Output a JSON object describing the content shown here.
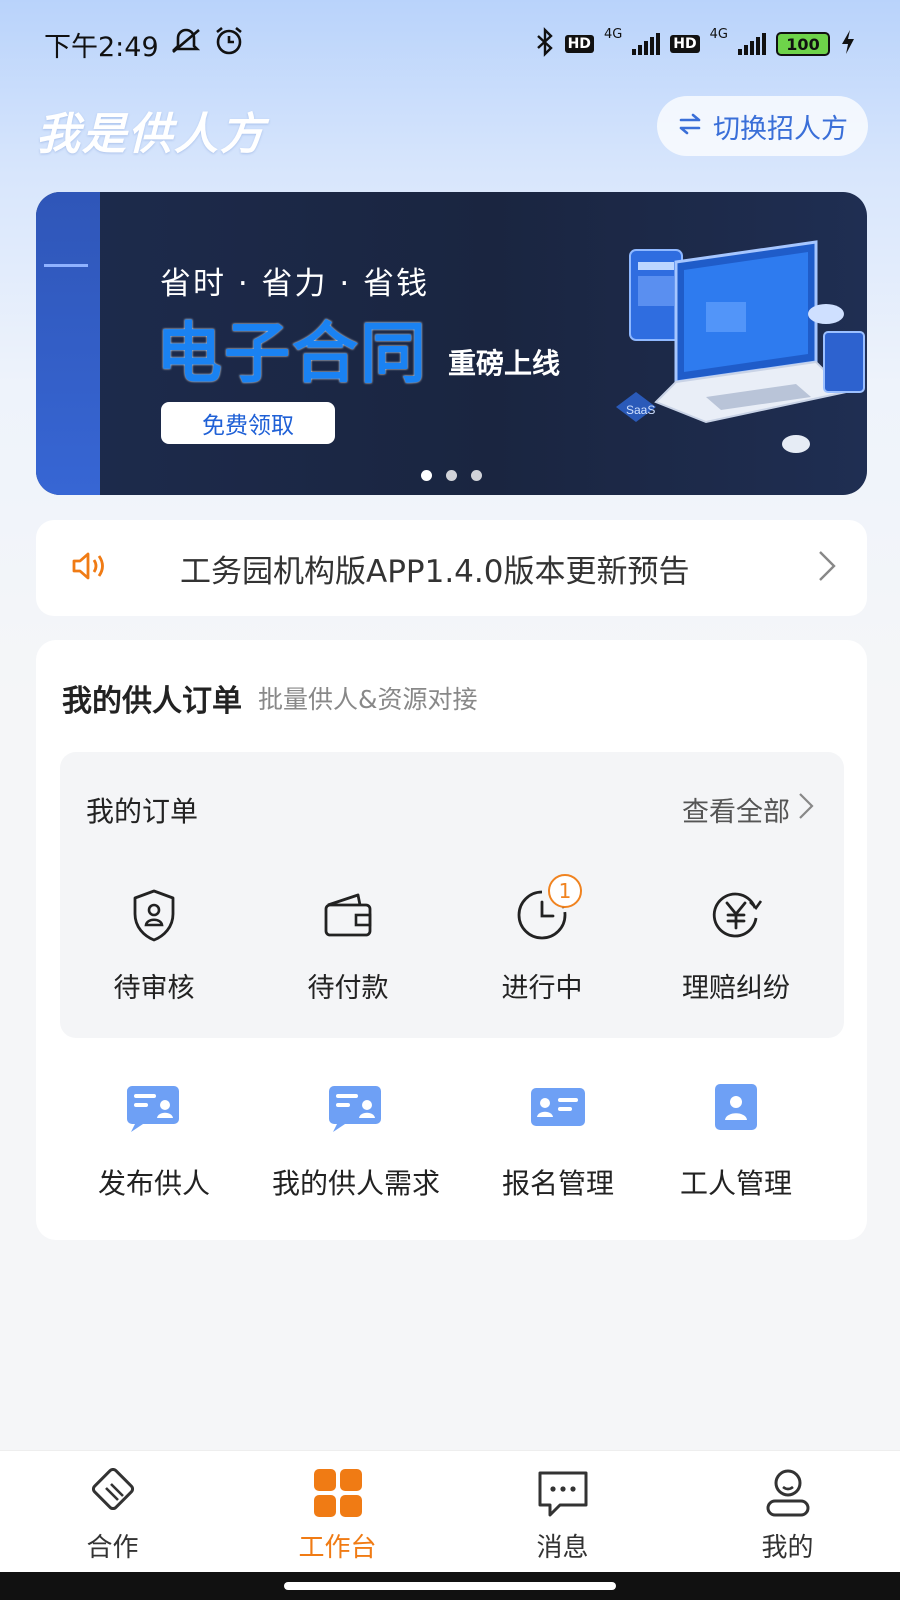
{
  "status_bar": {
    "time": "下午2:49",
    "hd1": "HD",
    "net1": "4G",
    "hd2": "HD",
    "net2": "4G",
    "battery": "100"
  },
  "header": {
    "title": "我是供人方",
    "switch_label": "切换招人方",
    "switch_icon": "swap-arrows-icon"
  },
  "banner": {
    "tagline": "省时 · 省力 · 省钱",
    "headline": "电子合同",
    "sub": "重磅上线",
    "cta": "免费领取",
    "art_label": "SaaS",
    "slide_count": 3
  },
  "notice": {
    "icon": "speaker-icon",
    "text": "工务园机构版APP1.4.0版本更新预告"
  },
  "supply_orders": {
    "title": "我的供人订单",
    "subtitle": "批量供人&资源对接",
    "orders": {
      "title": "我的订单",
      "view_all": "查看全部",
      "items": [
        {
          "label": "待审核",
          "icon": "shield-person-icon"
        },
        {
          "label": "待付款",
          "icon": "wallet-icon"
        },
        {
          "label": "进行中",
          "icon": "clock-icon",
          "badge": "1"
        },
        {
          "label": "理赔纠纷",
          "icon": "yen-refresh-icon"
        }
      ]
    },
    "tools": [
      {
        "label": "发布供人",
        "icon": "publish-card-icon"
      },
      {
        "label": "我的供人需求",
        "icon": "demand-card-icon"
      },
      {
        "label": "报名管理",
        "icon": "id-card-icon"
      },
      {
        "label": "工人管理",
        "icon": "worker-card-icon"
      }
    ]
  },
  "bottom_nav": {
    "items": [
      {
        "label": "合作",
        "icon": "handshake-icon"
      },
      {
        "label": "工作台",
        "icon": "grid-icon",
        "active": true
      },
      {
        "label": "消息",
        "icon": "chat-icon"
      },
      {
        "label": "我的",
        "icon": "user-icon"
      }
    ]
  },
  "colors": {
    "accent": "#f07b14",
    "primary": "#3a6fd8",
    "banner_bg": "#1d2b4d"
  }
}
